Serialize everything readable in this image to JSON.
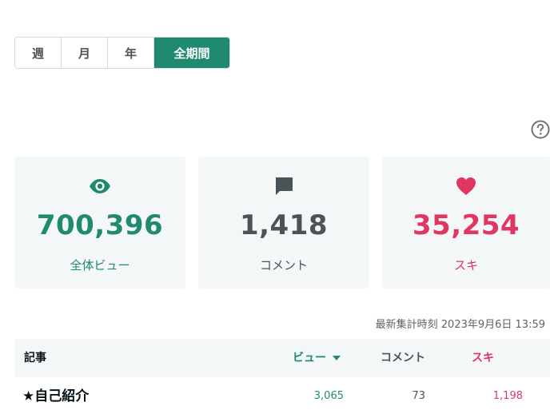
{
  "period_tabs": [
    {
      "label": "週"
    },
    {
      "label": "月"
    },
    {
      "label": "年"
    },
    {
      "label": "全期間",
      "active": true
    }
  ],
  "help_icon": "question-circle-icon",
  "stats": {
    "views": {
      "icon": "eye-icon",
      "value": "700,396",
      "label": "全体ビュー",
      "color": "#1f8a70"
    },
    "comments": {
      "icon": "comment-icon",
      "value": "1,418",
      "label": "コメント",
      "color": "#4a5458"
    },
    "likes": {
      "icon": "heart-icon",
      "value": "35,254",
      "label": "スキ",
      "color": "#e0365f"
    }
  },
  "updated_at": "最新集計時刻 2023年9月6日 13:59",
  "table": {
    "headers": {
      "article": "記事",
      "views": "ビュー",
      "comments": "コメント",
      "likes": "スキ"
    },
    "sort_icon": "caret-down-icon",
    "rows": [
      {
        "title": "★自己紹介",
        "views": "3,065",
        "comments": "73",
        "likes": "1,198"
      }
    ]
  }
}
